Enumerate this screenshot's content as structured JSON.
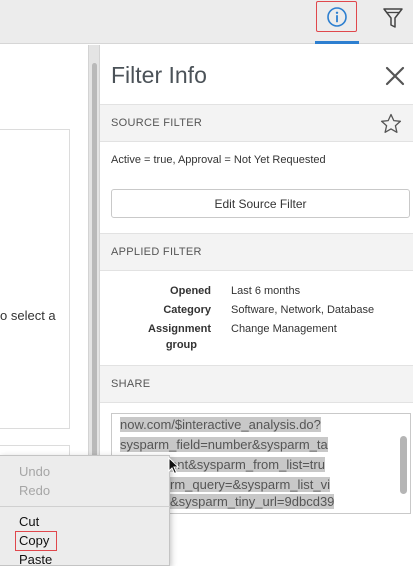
{
  "panel": {
    "title": "Filter Info",
    "source_filter": {
      "label": "SOURCE FILTER",
      "text": "Active = true, Approval = Not Yet Requested",
      "edit_button": "Edit Source Filter"
    },
    "applied_filter": {
      "label": "APPLIED FILTER",
      "rows": [
        {
          "key": "Opened",
          "value": "Last 6 months"
        },
        {
          "key": "Category",
          "value": "Software, Network, Database"
        },
        {
          "key_line1": "Assignment",
          "key_line2": "group",
          "value": "Change Management"
        }
      ]
    },
    "share": {
      "label": "SHARE",
      "lines": [
        "now.com/$interactive_analysis.do?",
        "sysparm_field=number&sysparm_ta",
        "ent&sysparm_from_list=tru",
        "rm_query=&sysparm_list_vi",
        "&sysparm_tiny_url=9dbcd39"
      ]
    }
  },
  "left": {
    "truncated_text": "o select a"
  },
  "context_menu": {
    "items": [
      "Undo",
      "Redo",
      "Cut",
      "Copy",
      "Paste"
    ]
  },
  "icons": {
    "info": "info-circle-icon",
    "filter": "funnel-filter-icon",
    "close": "close-x-icon",
    "star": "star-outline-icon"
  },
  "colors": {
    "accent_blue": "#2d7fd0",
    "highlight_red": "#e0474c"
  }
}
